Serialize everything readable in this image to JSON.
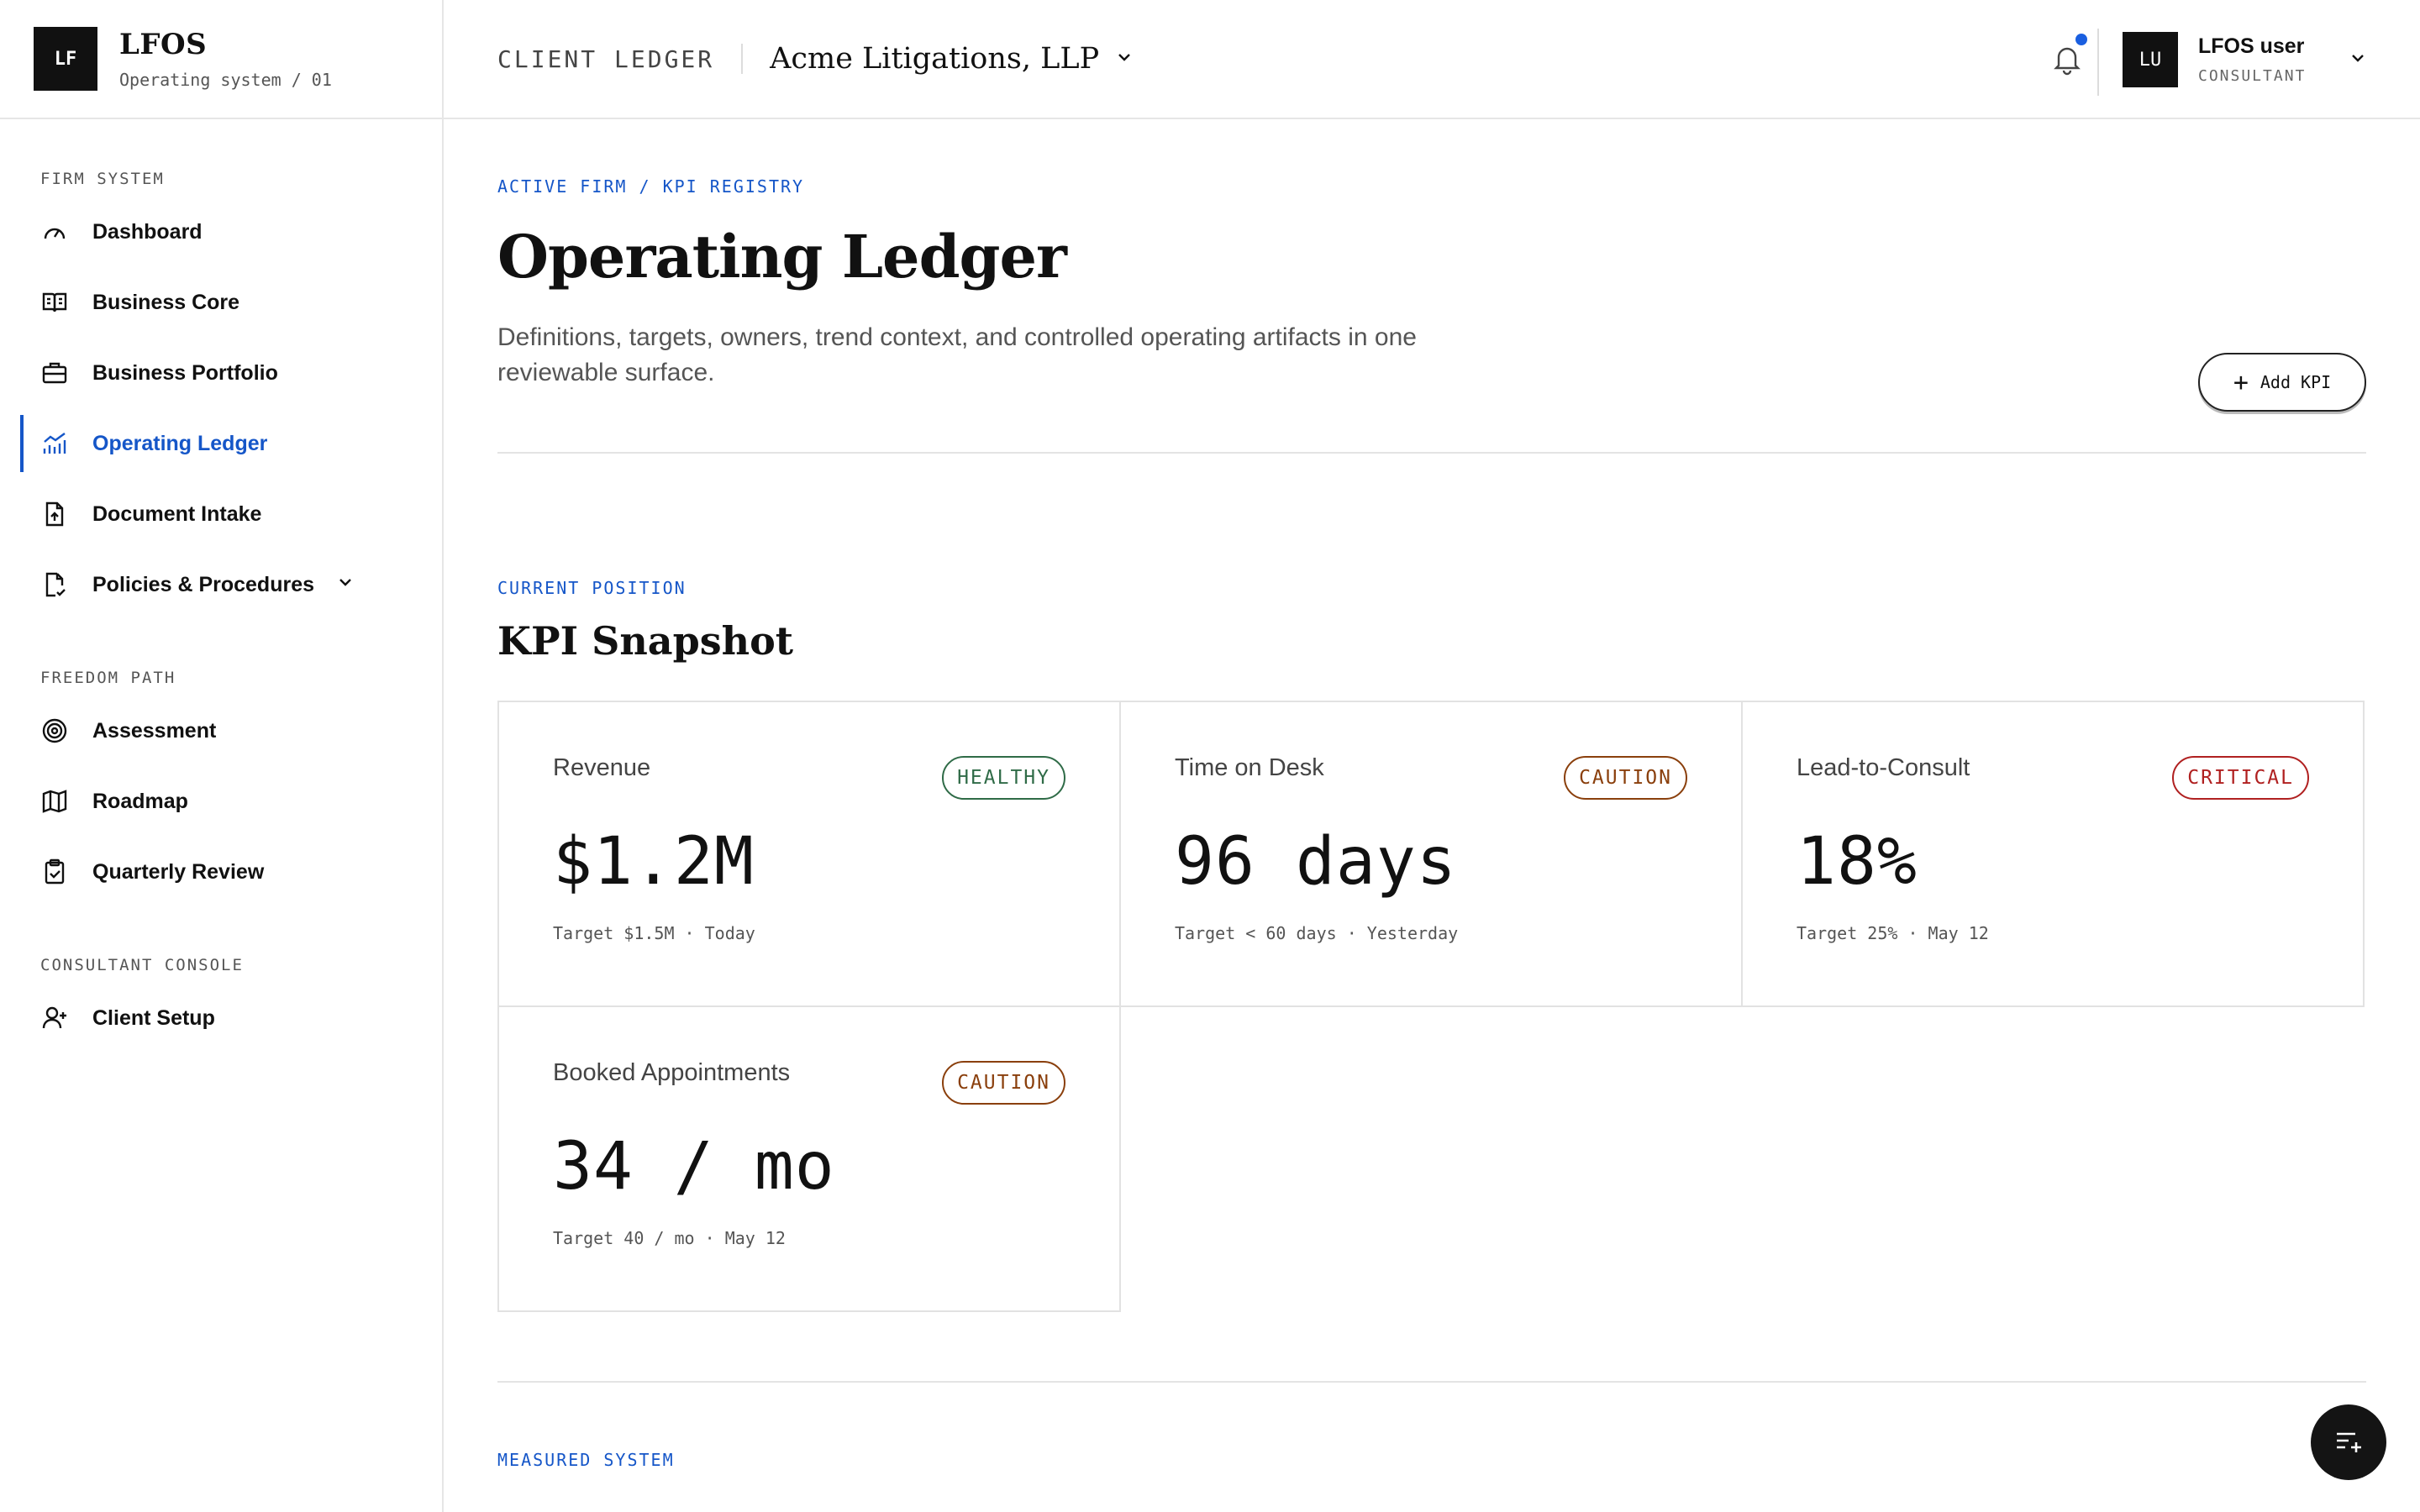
{
  "brand": {
    "logo": "LF",
    "title": "LFOS",
    "subtitle": "Operating system / 01"
  },
  "sidebar": {
    "sections": [
      {
        "heading": "FIRM SYSTEM",
        "items": [
          {
            "label": "Dashboard",
            "icon": "gauge-icon"
          },
          {
            "label": "Business Core",
            "icon": "book-icon"
          },
          {
            "label": "Business Portfolio",
            "icon": "briefcase-icon"
          },
          {
            "label": "Operating Ledger",
            "icon": "chart-icon",
            "active": true
          },
          {
            "label": "Document Intake",
            "icon": "file-upload-icon"
          },
          {
            "label": "Policies & Procedures",
            "icon": "file-check-icon",
            "expandable": true
          }
        ]
      },
      {
        "heading": "FREEDOM PATH",
        "items": [
          {
            "label": "Assessment",
            "icon": "target-icon"
          },
          {
            "label": "Roadmap",
            "icon": "map-icon"
          },
          {
            "label": "Quarterly Review",
            "icon": "clipboard-icon"
          }
        ]
      },
      {
        "heading": "CONSULTANT CONSOLE",
        "items": [
          {
            "label": "Client Setup",
            "icon": "user-plus-icon"
          }
        ]
      }
    ]
  },
  "header": {
    "label": "CLIENT LEDGER",
    "client": "Acme Litigations, LLP",
    "user": {
      "initials": "LU",
      "name": "LFOS user",
      "role": "CONSULTANT"
    }
  },
  "page": {
    "eyebrow": "ACTIVE FIRM / KPI REGISTRY",
    "title": "Operating Ledger",
    "description": "Definitions, targets, owners, trend context, and controlled operating artifacts in one reviewable surface.",
    "add_button": "Add KPI"
  },
  "snapshot": {
    "eyebrow": "CURRENT POSITION",
    "title": "KPI Snapshot",
    "cards": [
      {
        "label": "Revenue",
        "status": "HEALTHY",
        "value": "$1.2M",
        "meta": "Target $1.5M · Today"
      },
      {
        "label": "Time on Desk",
        "status": "CAUTION",
        "value": "96 days",
        "meta": "Target < 60 days · Yesterday"
      },
      {
        "label": "Lead-to-Consult",
        "status": "CRITICAL",
        "value": "18%",
        "meta": "Target 25% · May 12"
      },
      {
        "label": "Booked Appointments",
        "status": "CAUTION",
        "value": "34 / mo",
        "meta": "Target 40 / mo · May 12"
      }
    ]
  },
  "next_section": {
    "eyebrow": "MEASURED SYSTEM"
  },
  "colors": {
    "accent": "#1556c8",
    "healthy": "#2f6b47",
    "caution": "#8a3f0c",
    "critical": "#b02020"
  }
}
